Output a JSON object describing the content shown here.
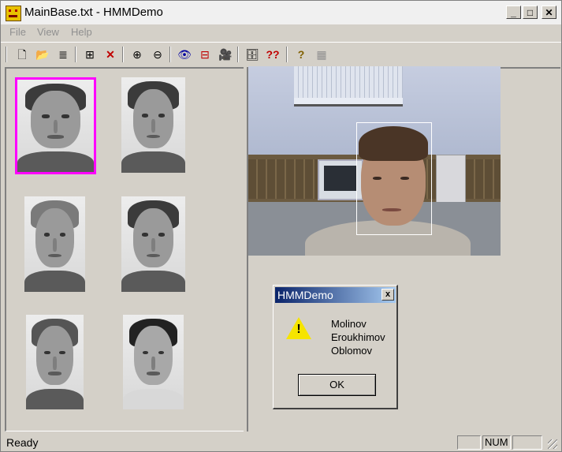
{
  "window": {
    "title": "MainBase.txt - HMMDemo"
  },
  "window_buttons": {
    "minimize": "_",
    "maximize": "□",
    "close": "✕"
  },
  "menu": {
    "items": [
      "File",
      "View",
      "Help"
    ]
  },
  "toolbar": {
    "icons": [
      "new-file-icon",
      "open-folder-icon",
      "list-icon",
      "add-face-icon",
      "delete-icon",
      "zoom-in-icon",
      "zoom-out-icon",
      "eye-icon",
      "split-icon",
      "camera-icon",
      "database-icon",
      "double-question-icon",
      "help-icon",
      "grid-icon"
    ],
    "glyphs": {
      "new": "🗋",
      "open": "📂",
      "list": "≣",
      "add": "⊞",
      "delete": "✕",
      "zoom_in": "⊕",
      "zoom_out": "⊖",
      "eye": "👁",
      "split": "⊟",
      "camera": "🎥",
      "db": "🗄",
      "qq": "??",
      "help": "?",
      "grid": "▦"
    }
  },
  "dialog": {
    "title": "HMMDemo",
    "close_label": "x",
    "warning_mark": "!",
    "lines": [
      "Molinov",
      "Eroukhimov",
      "Oblomov"
    ],
    "ok_label": "OK"
  },
  "status": {
    "text": "Ready",
    "num": "NUM"
  },
  "colors": {
    "selection": "#ff00ff",
    "dialog_title_start": "#0a246a",
    "warning": "#f6e400"
  }
}
